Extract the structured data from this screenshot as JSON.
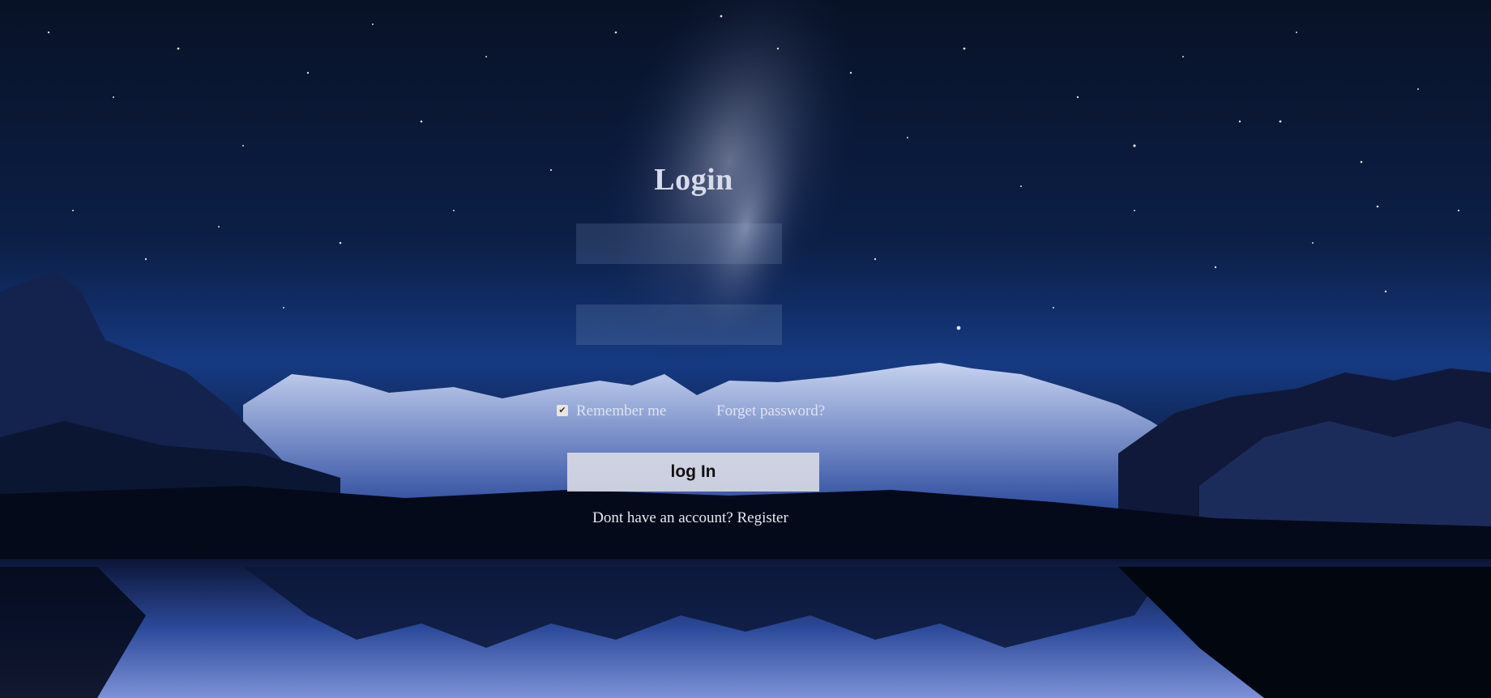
{
  "login": {
    "title": "Login",
    "username_value": "",
    "password_value": "",
    "remember_label": "Remember me",
    "remember_checked": true,
    "forget_label": "Forget password?",
    "submit_label": "log In",
    "register_prompt": "Dont have an account?",
    "register_link": "Register"
  },
  "colors": {
    "sky_top": "#081226",
    "sky_mid": "#163a82",
    "text": "#dfe3ef",
    "button_bg": "#e1e1e8"
  }
}
